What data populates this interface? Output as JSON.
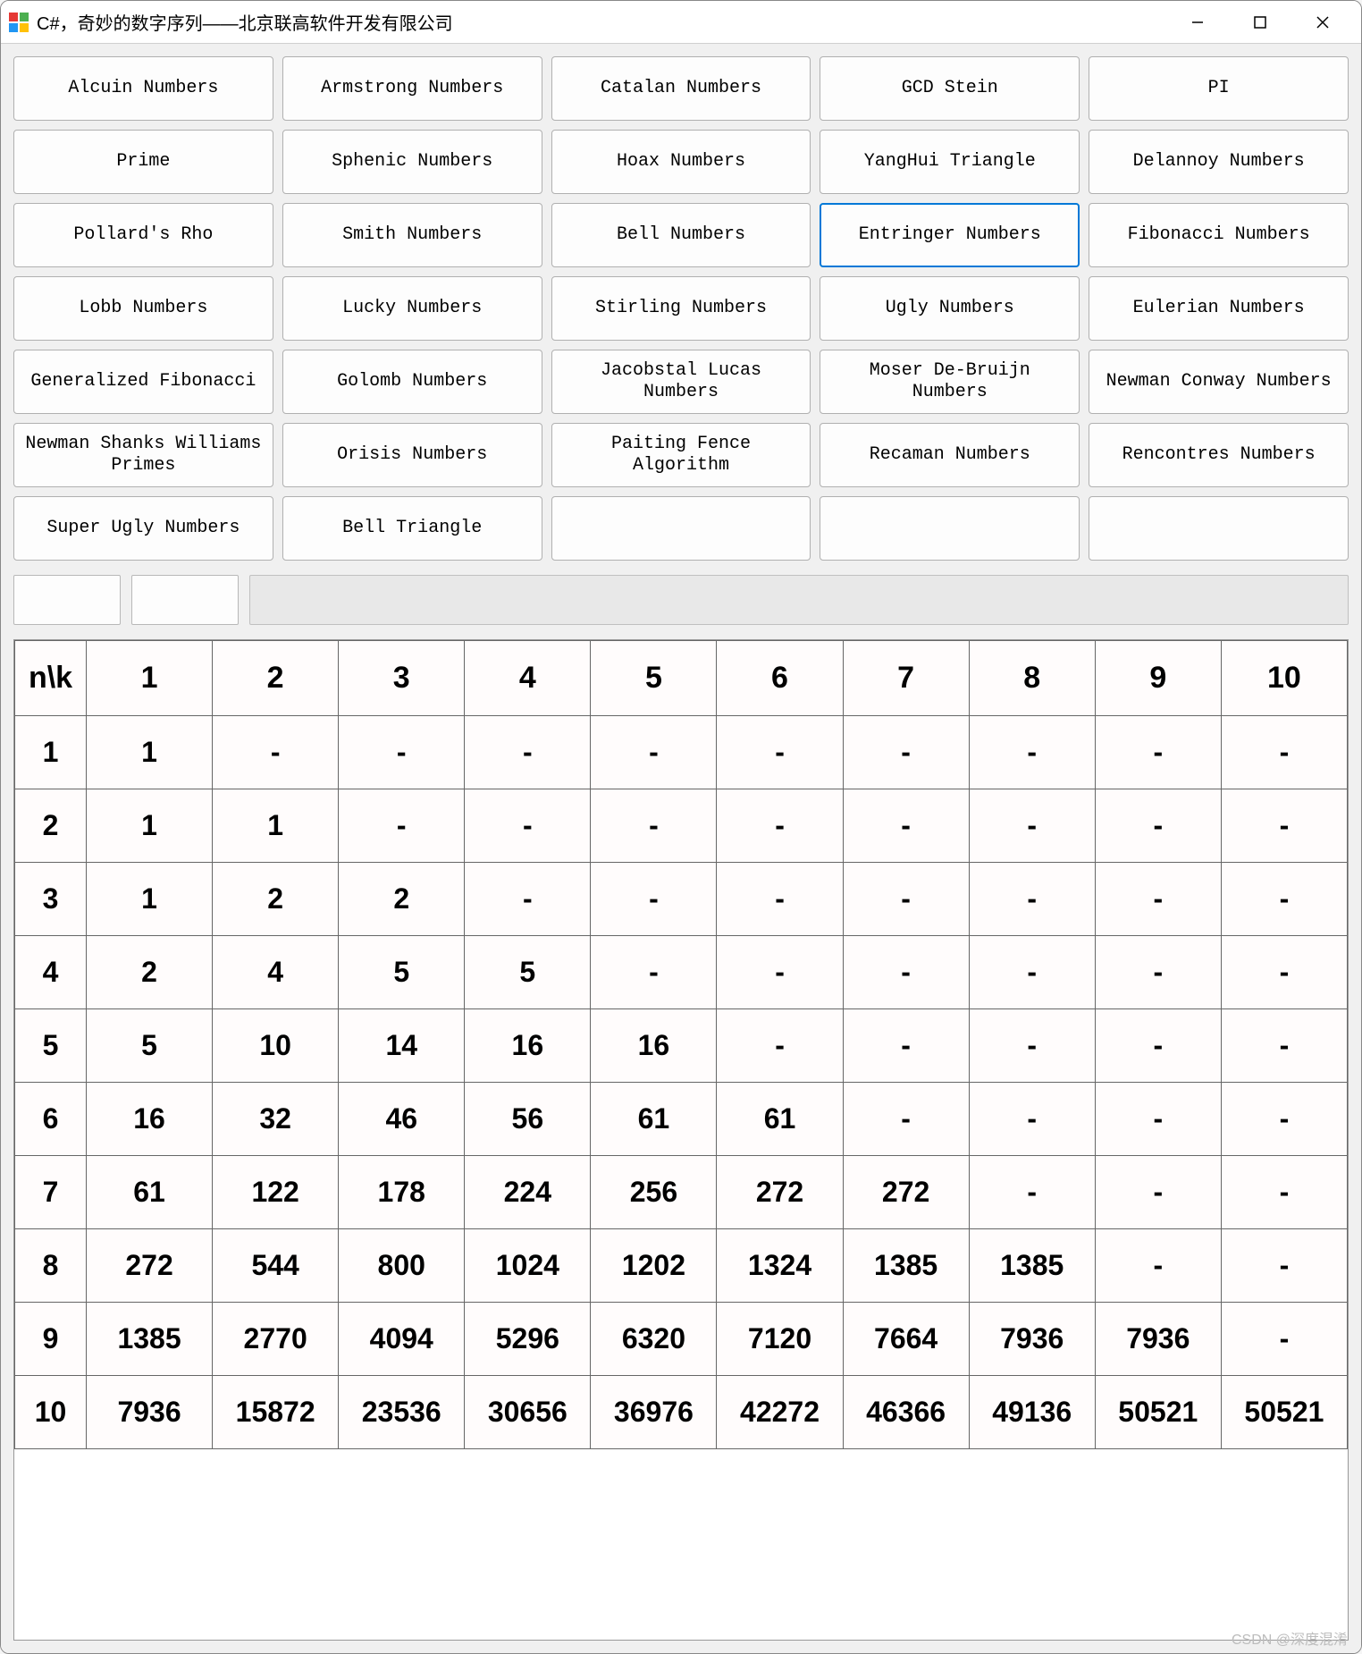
{
  "window": {
    "title": "C#，奇妙的数字序列——北京联高软件开发有限公司"
  },
  "buttons": [
    {
      "label": "Alcuin Numbers",
      "selected": false
    },
    {
      "label": "Armstrong Numbers",
      "selected": false
    },
    {
      "label": "Catalan Numbers",
      "selected": false
    },
    {
      "label": "GCD Stein",
      "selected": false
    },
    {
      "label": "PI",
      "selected": false
    },
    {
      "label": "Prime",
      "selected": false
    },
    {
      "label": "Sphenic Numbers",
      "selected": false
    },
    {
      "label": "Hoax Numbers",
      "selected": false
    },
    {
      "label": "YangHui Triangle",
      "selected": false
    },
    {
      "label": "Delannoy Numbers",
      "selected": false
    },
    {
      "label": "Pollard's Rho",
      "selected": false
    },
    {
      "label": "Smith Numbers",
      "selected": false
    },
    {
      "label": "Bell Numbers",
      "selected": false
    },
    {
      "label": "Entringer Numbers",
      "selected": true
    },
    {
      "label": "Fibonacci Numbers",
      "selected": false
    },
    {
      "label": "Lobb Numbers",
      "selected": false
    },
    {
      "label": "Lucky Numbers",
      "selected": false
    },
    {
      "label": "Stirling Numbers",
      "selected": false
    },
    {
      "label": "Ugly Numbers",
      "selected": false
    },
    {
      "label": "Eulerian Numbers",
      "selected": false
    },
    {
      "label": "Generalized Fibonacci",
      "selected": false
    },
    {
      "label": "Golomb Numbers",
      "selected": false
    },
    {
      "label": "Jacobstal Lucas Numbers",
      "selected": false
    },
    {
      "label": "Moser De-Bruijn Numbers",
      "selected": false
    },
    {
      "label": "Newman Conway Numbers",
      "selected": false
    },
    {
      "label": "Newman Shanks Williams Primes",
      "selected": false
    },
    {
      "label": "Orisis Numbers",
      "selected": false
    },
    {
      "label": "Paiting Fence Algorithm",
      "selected": false
    },
    {
      "label": "Recaman Numbers",
      "selected": false
    },
    {
      "label": "Rencontres Numbers",
      "selected": false
    },
    {
      "label": "Super Ugly Numbers",
      "selected": false
    },
    {
      "label": "Bell Triangle",
      "selected": false
    },
    {
      "label": "",
      "selected": false
    },
    {
      "label": "",
      "selected": false
    },
    {
      "label": "",
      "selected": false
    }
  ],
  "table": {
    "corner": "n\\k",
    "col_headers": [
      "1",
      "2",
      "3",
      "4",
      "5",
      "6",
      "7",
      "8",
      "9",
      "10"
    ],
    "rows": [
      {
        "head": "1",
        "cells": [
          "1",
          "-",
          "-",
          "-",
          "-",
          "-",
          "-",
          "-",
          "-",
          "-"
        ]
      },
      {
        "head": "2",
        "cells": [
          "1",
          "1",
          "-",
          "-",
          "-",
          "-",
          "-",
          "-",
          "-",
          "-"
        ]
      },
      {
        "head": "3",
        "cells": [
          "1",
          "2",
          "2",
          "-",
          "-",
          "-",
          "-",
          "-",
          "-",
          "-"
        ]
      },
      {
        "head": "4",
        "cells": [
          "2",
          "4",
          "5",
          "5",
          "-",
          "-",
          "-",
          "-",
          "-",
          "-"
        ]
      },
      {
        "head": "5",
        "cells": [
          "5",
          "10",
          "14",
          "16",
          "16",
          "-",
          "-",
          "-",
          "-",
          "-"
        ]
      },
      {
        "head": "6",
        "cells": [
          "16",
          "32",
          "46",
          "56",
          "61",
          "61",
          "-",
          "-",
          "-",
          "-"
        ]
      },
      {
        "head": "7",
        "cells": [
          "61",
          "122",
          "178",
          "224",
          "256",
          "272",
          "272",
          "-",
          "-",
          "-"
        ]
      },
      {
        "head": "8",
        "cells": [
          "272",
          "544",
          "800",
          "1024",
          "1202",
          "1324",
          "1385",
          "1385",
          "-",
          "-"
        ]
      },
      {
        "head": "9",
        "cells": [
          "1385",
          "2770",
          "4094",
          "5296",
          "6320",
          "7120",
          "7664",
          "7936",
          "7936",
          "-"
        ]
      },
      {
        "head": "10",
        "cells": [
          "7936",
          "15872",
          "23536",
          "30656",
          "36976",
          "42272",
          "46366",
          "49136",
          "50521",
          "50521"
        ]
      }
    ]
  },
  "watermark": "CSDN @深度混淆",
  "chart_data": {
    "type": "table",
    "title": "Entringer Numbers",
    "xlabel": "k",
    "ylabel": "n",
    "categories": [
      1,
      2,
      3,
      4,
      5,
      6,
      7,
      8,
      9,
      10
    ],
    "series": [
      {
        "name": "n=1",
        "values": [
          1,
          null,
          null,
          null,
          null,
          null,
          null,
          null,
          null,
          null
        ]
      },
      {
        "name": "n=2",
        "values": [
          1,
          1,
          null,
          null,
          null,
          null,
          null,
          null,
          null,
          null
        ]
      },
      {
        "name": "n=3",
        "values": [
          1,
          2,
          2,
          null,
          null,
          null,
          null,
          null,
          null,
          null
        ]
      },
      {
        "name": "n=4",
        "values": [
          2,
          4,
          5,
          5,
          null,
          null,
          null,
          null,
          null,
          null
        ]
      },
      {
        "name": "n=5",
        "values": [
          5,
          10,
          14,
          16,
          16,
          null,
          null,
          null,
          null,
          null
        ]
      },
      {
        "name": "n=6",
        "values": [
          16,
          32,
          46,
          56,
          61,
          61,
          null,
          null,
          null,
          null
        ]
      },
      {
        "name": "n=7",
        "values": [
          61,
          122,
          178,
          224,
          256,
          272,
          272,
          null,
          null,
          null
        ]
      },
      {
        "name": "n=8",
        "values": [
          272,
          544,
          800,
          1024,
          1202,
          1324,
          1385,
          1385,
          null,
          null
        ]
      },
      {
        "name": "n=9",
        "values": [
          1385,
          2770,
          4094,
          5296,
          6320,
          7120,
          7664,
          7936,
          7936,
          null
        ]
      },
      {
        "name": "n=10",
        "values": [
          7936,
          15872,
          23536,
          30656,
          36976,
          42272,
          46366,
          49136,
          50521,
          50521
        ]
      }
    ]
  }
}
